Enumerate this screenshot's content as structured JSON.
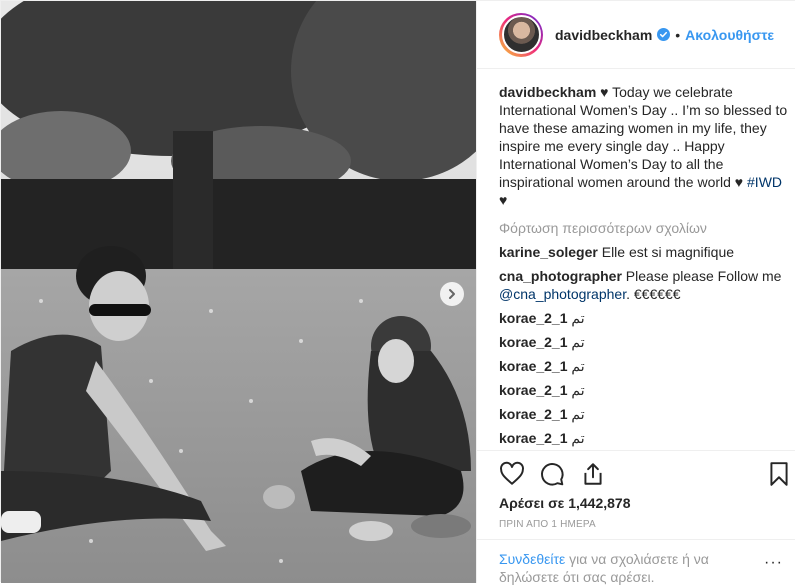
{
  "header": {
    "username": "davidbeckham",
    "separator": "•",
    "follow_label": "Ακολουθήστε"
  },
  "caption": {
    "username": "davidbeckham",
    "text": " ♥ Today we celebrate International Women’s Day .. I’m so blessed to have these amazing women in my life, they inspire me every single day .. Happy International Women’s Day to all the inspirational women around the world ♥ ",
    "hashtag": "#IWD",
    "tail": " ♥"
  },
  "load_more_label": "Φόρτωση περισσότερων σχολίων",
  "comments": [
    {
      "user": "karine_soleger",
      "text": " Elle est si magnifique"
    },
    {
      "user": "cna_photographer",
      "text": " Please please Follow me ",
      "mention": "@cna_photographer",
      "tail": ". €€€€€€"
    },
    {
      "user": "korae_2_1",
      "text": " تم"
    },
    {
      "user": "korae_2_1",
      "text": " تم"
    },
    {
      "user": "korae_2_1",
      "text": " تم"
    },
    {
      "user": "korae_2_1",
      "text": " تم"
    },
    {
      "user": "korae_2_1",
      "text": " تم"
    },
    {
      "user": "korae_2_1",
      "text": " تم"
    }
  ],
  "likes_label": "Αρέσει σε 1,442,878",
  "time_label": "ΠΡΙΝ ΑΠΟ 1 ΗΜΕΡΑ",
  "login": {
    "link": "Συνδεθείτε",
    "text": " για να σχολιάσετε ή να δηλώσετε ότι σας αρέσει."
  },
  "more_options": "···",
  "icons": {
    "verified": "verified-badge-icon",
    "like": "heart-icon",
    "comment": "comment-bubble-icon",
    "share": "share-icon",
    "save": "bookmark-icon",
    "next": "chevron-right-icon"
  },
  "colors": {
    "accent": "#3897f0",
    "link": "#003569",
    "muted": "#999999",
    "text": "#262626"
  }
}
